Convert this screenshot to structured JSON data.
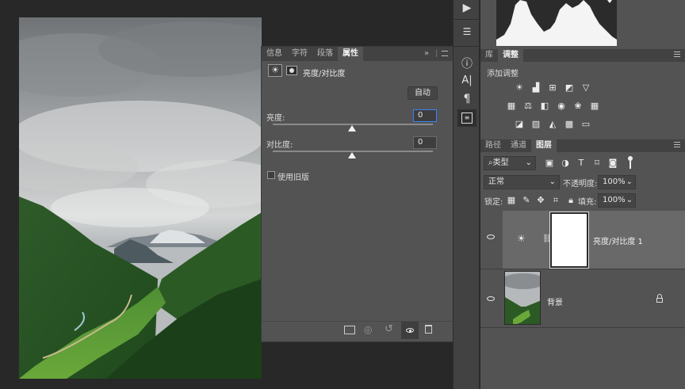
{
  "props_panel": {
    "tabs": [
      "信息",
      "字符",
      "段落",
      "属性"
    ],
    "active_tab": "属性",
    "collapse_label": "»",
    "title": "亮度/对比度",
    "auto_button": "自动",
    "brightness_label": "亮度:",
    "brightness_value": "0",
    "contrast_label": "对比度:",
    "contrast_value": "0",
    "legacy_label": "使用旧版"
  },
  "adjustments_panel": {
    "tabs": [
      "库",
      "调整"
    ],
    "active_tab": "调整",
    "add_label": "添加调整"
  },
  "layers_panel": {
    "tabs": [
      "路径",
      "通道",
      "图层"
    ],
    "active_tab": "图层",
    "filter_kind": "类型",
    "blend_mode": "正常",
    "opacity_label": "不透明度:",
    "opacity_value": "100%",
    "lock_label": "锁定:",
    "fill_label": "填充:",
    "fill_value": "100%",
    "layers": [
      {
        "name": "亮度/对比度 1"
      },
      {
        "name": "背景"
      }
    ]
  },
  "colors": {
    "panel_bg": "#535353",
    "tab_bar": "#424242",
    "selected_layer": "#696969",
    "field_focus": "#3b82f6"
  }
}
